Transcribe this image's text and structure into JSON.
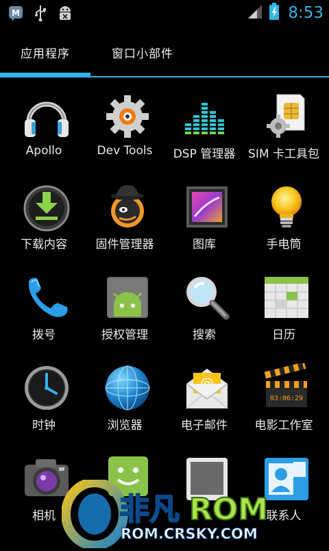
{
  "status_bar": {
    "icons": [
      "app-notification-icon",
      "usb-icon",
      "android-debug-icon"
    ],
    "time": "8:53",
    "battery_state": "charging",
    "colors": {
      "accent": "#33b5e5"
    }
  },
  "tabs": [
    {
      "label": "应用程序",
      "selected": true
    },
    {
      "label": "窗口小部件",
      "selected": false
    }
  ],
  "apps": [
    {
      "label": "Apollo",
      "icon": "headphones-icon"
    },
    {
      "label": "Dev Tools",
      "icon": "dev-tools-gear-icon"
    },
    {
      "label": "DSP 管理器",
      "icon": "equalizer-icon"
    },
    {
      "label": "SIM 卡工具包",
      "icon": "sim-card-icon"
    },
    {
      "label": "下载内容",
      "icon": "download-icon"
    },
    {
      "label": "固件管理器",
      "icon": "rom-manager-icon"
    },
    {
      "label": "图库",
      "icon": "gallery-icon"
    },
    {
      "label": "手电筒",
      "icon": "flashlight-icon"
    },
    {
      "label": "拨号",
      "icon": "phone-icon"
    },
    {
      "label": "授权管理",
      "icon": "superuser-icon"
    },
    {
      "label": "搜索",
      "icon": "magnifier-icon"
    },
    {
      "label": "日历",
      "icon": "calendar-icon"
    },
    {
      "label": "时钟",
      "icon": "clock-icon"
    },
    {
      "label": "浏览器",
      "icon": "globe-icon"
    },
    {
      "label": "电子邮件",
      "icon": "email-icon"
    },
    {
      "label": "电影工作室",
      "icon": "clapperboard-icon"
    },
    {
      "label": "相机",
      "icon": "camera-icon"
    },
    {
      "label": "",
      "icon": "android-market-icon"
    },
    {
      "label": "",
      "icon": "tablet-icon"
    },
    {
      "label": "联系人",
      "icon": "contacts-icon"
    }
  ],
  "watermark": {
    "brand": "非凡ROM",
    "url": "ROM.CRSKY.COM"
  }
}
